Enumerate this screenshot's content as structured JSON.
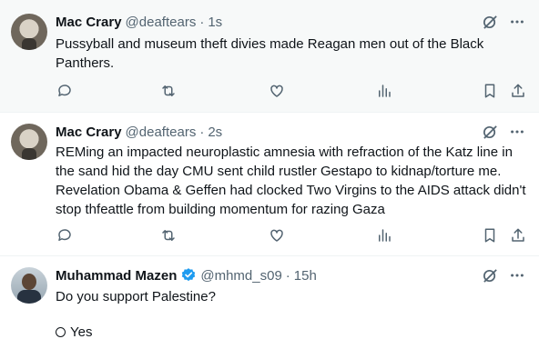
{
  "colors": {
    "text_primary": "#0f1419",
    "text_secondary": "#536471",
    "hover_bg": "#f7f9f9",
    "divider": "#eff3f4",
    "verified_blue": "#1d9bf0"
  },
  "tweets": [
    {
      "name": "Mac Crary",
      "handle": "@deaftears",
      "dot": "·",
      "time": "1s",
      "text": "Pussyball and museum theft divies made Reagan men out of the Black Panthers.",
      "verified": false
    },
    {
      "name": "Mac Crary",
      "handle": "@deaftears",
      "dot": "·",
      "time": "2s",
      "text": "REMing an impacted neuroplastic amnesia with refraction of the Katz line in the sand hid the day CMU sent child rustler Gestapo to kidnap/torture me.  Revelation Obama & Geffen had clocked Two Virgins to the AIDS attack didn't stop thfeattle from building momentum for razing Gaza",
      "verified": false
    },
    {
      "name": "Muhammad Mazen",
      "handle": "@mhmd_s09",
      "dot": "·",
      "time": "15h",
      "text": "Do you support Palestine?",
      "verified": true,
      "poll_options": [
        "Yes"
      ]
    }
  ],
  "icons": {
    "reply": "reply-icon",
    "retweet": "retweet-icon",
    "like": "heart-icon",
    "views": "views-icon",
    "bookmark": "bookmark-icon",
    "share": "share-icon",
    "grok": "grok-icon",
    "more": "more-icon"
  }
}
